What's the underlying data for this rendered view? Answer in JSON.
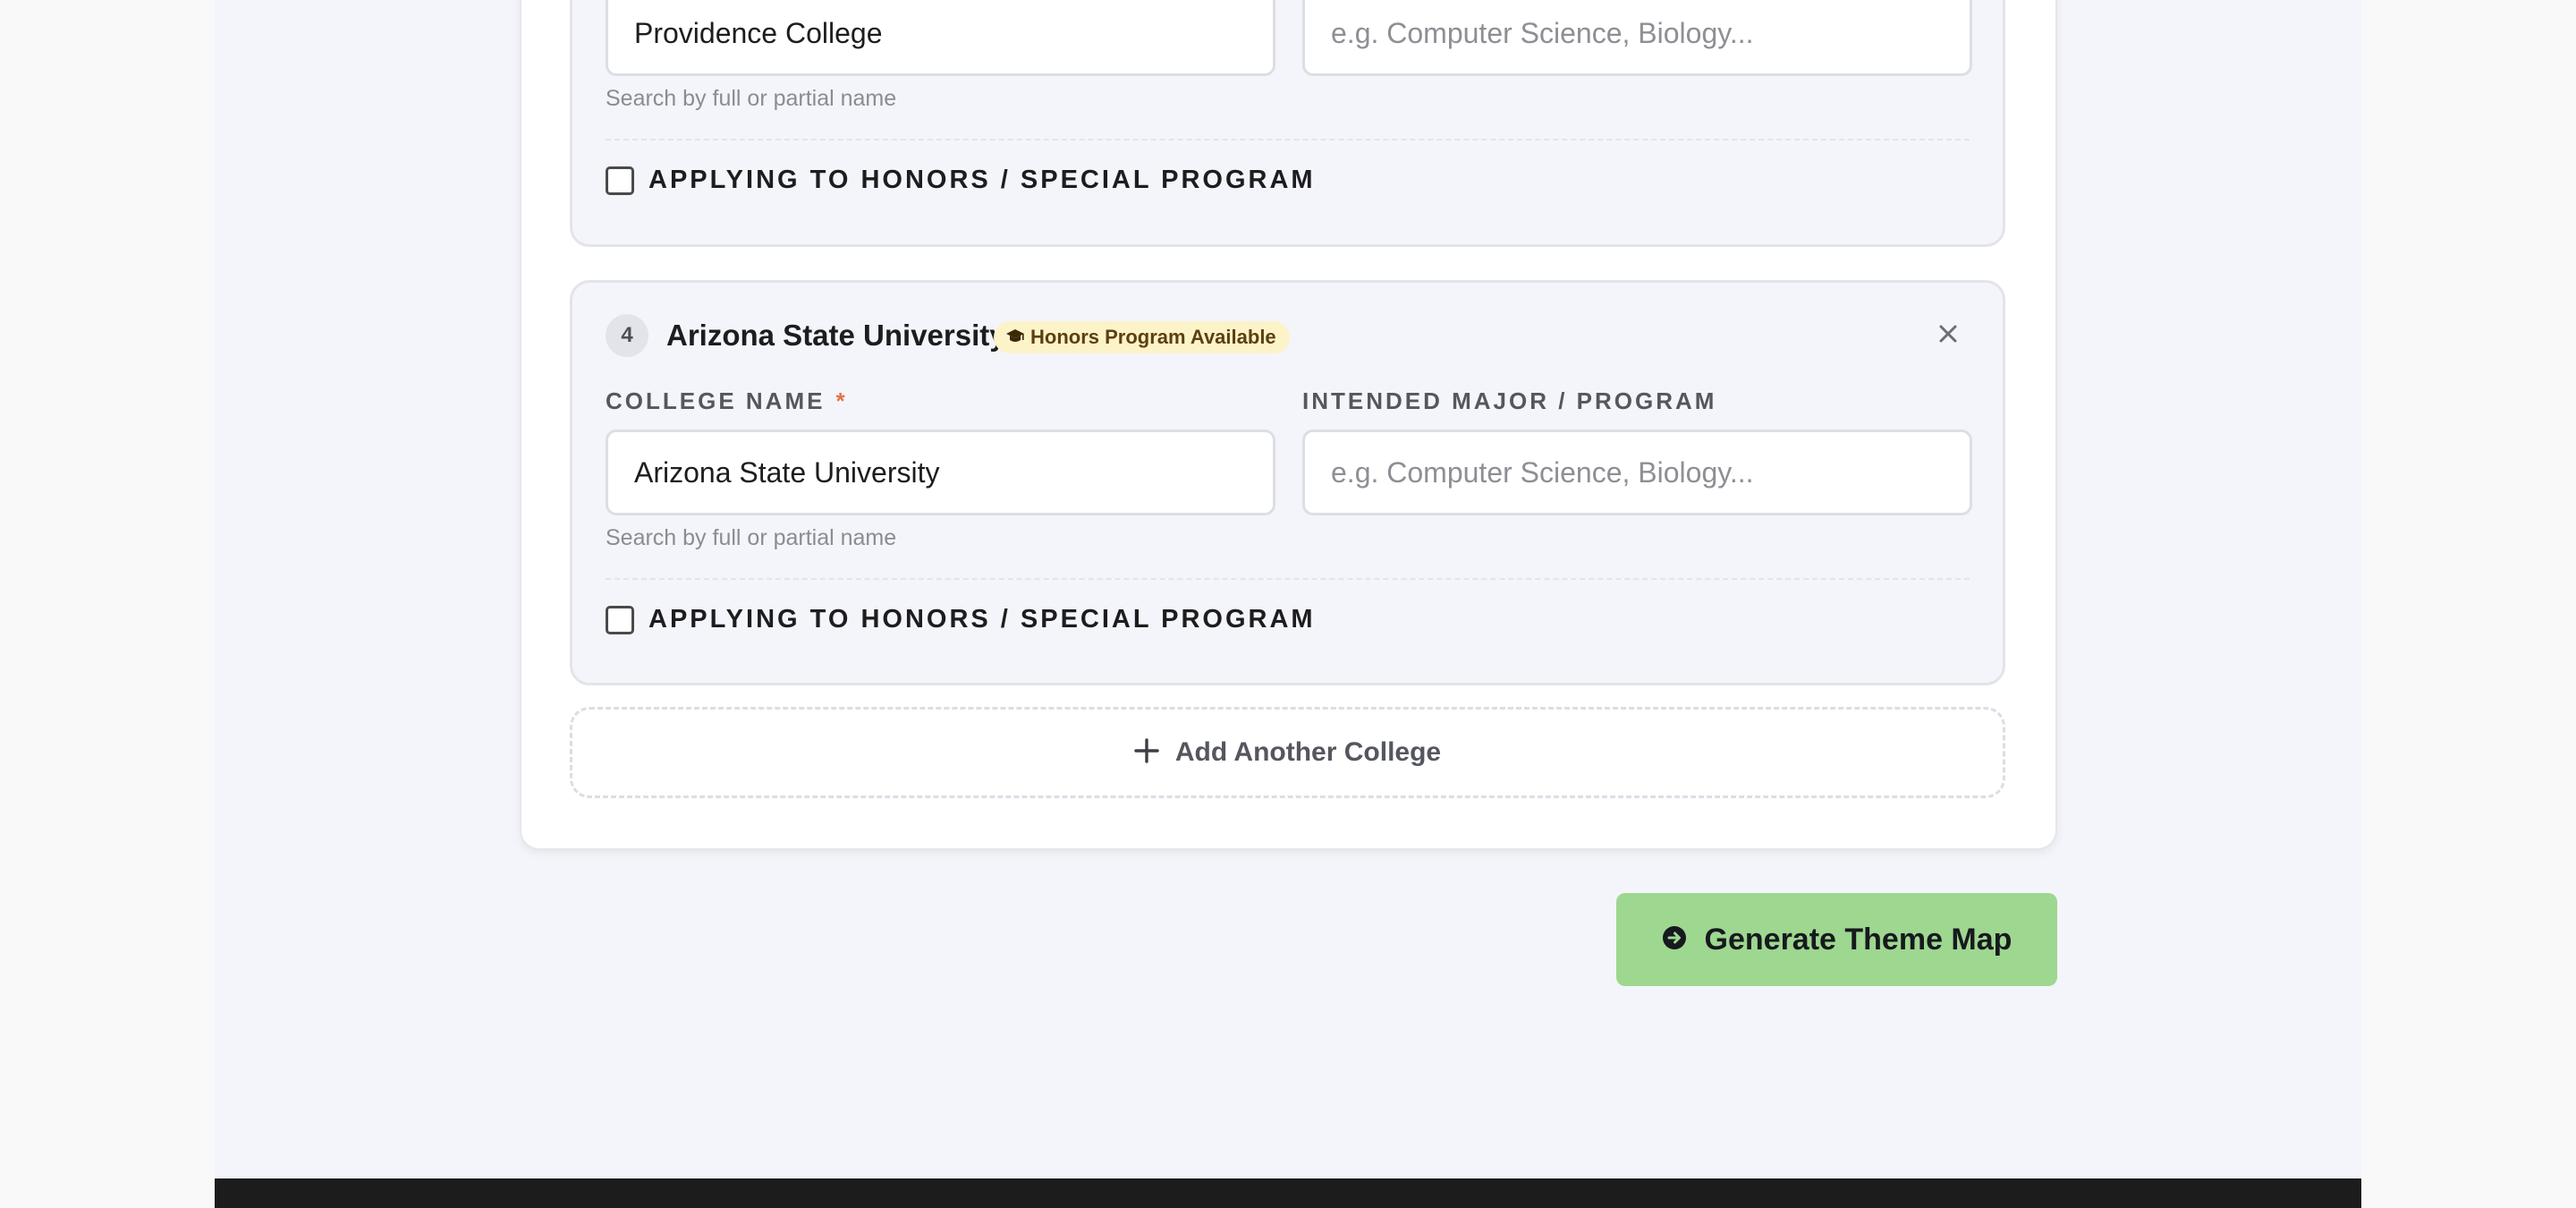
{
  "colleges": [
    {
      "college_name_value": "Providence College",
      "major_placeholder": "e.g. Computer Science, Biology...",
      "hint": "Search by full or partial name",
      "honors_checkbox_label": "APPLYING TO HONORS / SPECIAL PROGRAM",
      "honors_checked": false
    },
    {
      "number": "4",
      "title": "Arizona State University",
      "honors_badge": "Honors Program Available",
      "college_name_label": "COLLEGE NAME",
      "required_marker": "*",
      "major_label": "INTENDED MAJOR / PROGRAM",
      "college_name_value": "Arizona State University",
      "major_placeholder": "e.g. Computer Science, Biology...",
      "hint": "Search by full or partial name",
      "honors_checkbox_label": "APPLYING TO HONORS / SPECIAL PROGRAM",
      "honors_checked": false
    }
  ],
  "add_college_label": "Add Another College",
  "submit_label": "Generate Theme Map",
  "icons": {
    "badge": "graduation-cap-icon",
    "remove": "close-icon",
    "add": "plus-icon",
    "submit": "arrow-circle-right-icon"
  },
  "colors": {
    "submit_button": "#9ed790",
    "honors_badge_bg": "#fdf3c9",
    "required_marker": "#e2724c",
    "footer": "#1c1c1c"
  }
}
